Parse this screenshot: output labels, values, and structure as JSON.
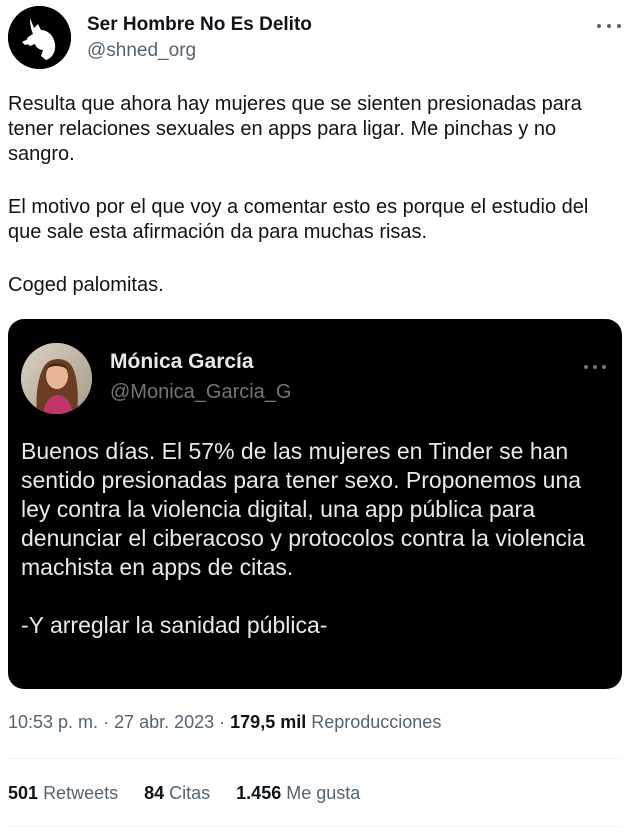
{
  "author": {
    "name": "Ser Hombre No Es Delito",
    "handle": "@shned_org",
    "avatar_icon": "wolf-silhouette-icon"
  },
  "tweet": {
    "paragraphs": [
      "Resulta que ahora hay mujeres que se sienten presionadas para tener relaciones sexuales en apps para ligar. Me pinchas y no sangro.",
      "El motivo por el que voy a comentar esto es porque el estudio del que sale esta afirmación da para muchas risas.",
      "Coged palomitas."
    ]
  },
  "quoted": {
    "name": "Mónica García",
    "handle": "@Monica_Garcia_G",
    "paragraphs": [
      "Buenos días. El 57% de las mujeres en Tinder se han sentido presionadas para tener sexo. Proponemos una ley contra la violencia digital, una app pública para denunciar el ciberacoso y protocolos contra la violencia machista en apps de citas.",
      "-Y arreglar la sanidad pública-"
    ]
  },
  "meta": {
    "time": "10:53 p. m.",
    "sep1": " · ",
    "date": "27 abr. 2023",
    "sep2": " · ",
    "views": "179,5 mil",
    "views_label": "Reproducciones"
  },
  "stats": {
    "retweets_count": "501",
    "retweets_label": "Retweets",
    "quotes_count": "84",
    "quotes_label": "Citas",
    "likes_count": "1.456",
    "likes_label": "Me gusta"
  },
  "colors": {
    "text": "#0f1419",
    "secondary": "#536471",
    "quote_bg": "#000000",
    "quote_text": "#e7e9ea"
  }
}
